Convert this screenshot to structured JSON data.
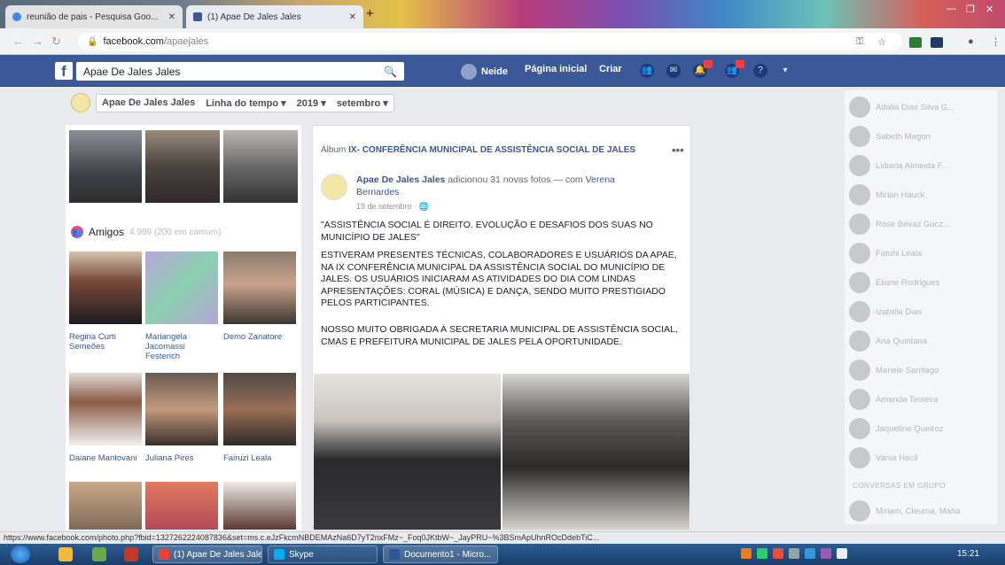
{
  "browser": {
    "tabs": [
      {
        "label": "reunião de pais - Pesquisa Goo..."
      },
      {
        "label": "(1) Apae De Jales Jales"
      }
    ],
    "url_host": "facebook.com",
    "url_path": "/apaejales",
    "status_url": "https://www.facebook.com/photo.php?fbid=1327262224087836&set=ms.c.eJzFkcmNBDEMAzNa6D7yT2nxFMz~_Foq0JKtbW~_JayPRU~%3BSmApUhnROcDdebTiC..."
  },
  "facebook": {
    "search_value": "Apae De Jales Jales",
    "nav": {
      "user": "Neide",
      "home": "Página inicial",
      "create": "Criar"
    }
  },
  "timeline_nav": {
    "page": "Apae De Jales Jales",
    "section": "Linha do tempo",
    "year": "2019",
    "month": "setembro"
  },
  "friends": {
    "title": "Amigos",
    "count": "4.999 (200 em comum)",
    "items": [
      {
        "name": "Regina Curti Semeões"
      },
      {
        "name": "Mariangela Jacomassi Festerich"
      },
      {
        "name": "Demo Zanatore"
      },
      {
        "name": "Daiane Mantovani"
      },
      {
        "name": "Juliana Pires"
      },
      {
        "name": "Fairuzi Leala"
      }
    ]
  },
  "post": {
    "album_prefix": "Álbum",
    "album_title": "IX- CONFERÊNCIA MUNICIPAL DE ASSISTÊNCIA SOCIAL DE JALES",
    "author": "Apae De Jales Jales",
    "action": "adicionou 31 novas fotos — com",
    "tagged": "Verena Bernardes",
    "date": "19 de setembro",
    "paragraphs": [
      "\"ASSISTÊNCIA SOCIAL É DIREITO. EVOLUÇÃO E DESAFIOS DOS SUAS NO MUNICÍPIO DE JALES\"",
      "ESTIVERAM PRESENTES TÉCNICAS, COLABORADORES E USUÁRIOS DA APAE, NA IX CONFERÊNCIA MUNICIPAL DA ASSISTÊNCIA SOCIAL DO MUNICÍPIO DE JALES. OS USUÁRIOS INICIARAM AS ATIVIDADES DO DIA COM LINDAS APRESENTAÇÕES: CORAL (MÚSICA) E DANÇA, SENDO MUITO PRESTIGIADO PELOS PARTICIPANTES.",
      "NOSSO MUITO OBRIGADA À SECRETARIA MUNICIPAL DE ASSISTÊNCIA SOCIAL, CMAS E PREFEITURA MUNICIPAL DE JALES PELA OPORTUNIDADE."
    ]
  },
  "chat": {
    "contacts": [
      {
        "name": "Adalia Dias Silva G..."
      },
      {
        "name": "Sabeth Magon"
      },
      {
        "name": "Lidiana Almeida F..."
      },
      {
        "name": "Mirian Hauck"
      },
      {
        "name": "Rose Bevaz Gucz..."
      },
      {
        "name": "Fatuhi Leala"
      },
      {
        "name": "Eliane Rodrigues"
      },
      {
        "name": "Izabela Dias"
      },
      {
        "name": "Ana Quintana"
      },
      {
        "name": "Mariele Santiago"
      },
      {
        "name": "Amanda Teixeira"
      },
      {
        "name": "Jaqueline Queiroz"
      },
      {
        "name": "Vania Hecil"
      }
    ],
    "section_label": "CONVERSAS EM GRUPO",
    "group": "Miriam, Cleuma, Mahala e..."
  },
  "taskbar": {
    "items": [
      {
        "label": "(1) Apae De Jales Jale..."
      },
      {
        "label": "Skype"
      },
      {
        "label": "Documento1 - Micro..."
      }
    ],
    "clock": "15:21"
  }
}
